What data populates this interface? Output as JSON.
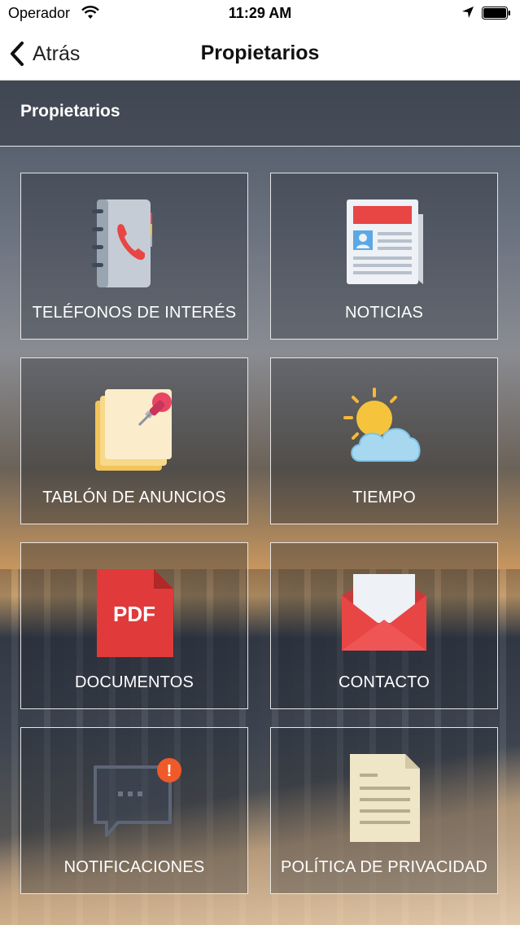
{
  "status_bar": {
    "carrier": "Operador",
    "time": "11:29 AM"
  },
  "nav": {
    "back_label": "Atrás",
    "title": "Propietarios"
  },
  "section": {
    "title": "Propietarios"
  },
  "tiles": [
    {
      "label": "TELÉFONOS DE INTERÉS",
      "icon": "phonebook-icon"
    },
    {
      "label": "NOTICIAS",
      "icon": "newspaper-icon"
    },
    {
      "label": "TABLÓN DE ANUNCIOS",
      "icon": "sticky-notes-icon"
    },
    {
      "label": "TIEMPO",
      "icon": "weather-icon"
    },
    {
      "label": "DOCUMENTOS",
      "icon": "pdf-icon",
      "icon_text": "PDF"
    },
    {
      "label": "CONTACTO",
      "icon": "envelope-icon"
    },
    {
      "label": "NOTIFICACIONES",
      "icon": "chat-bubble-icon",
      "badge": "!"
    },
    {
      "label": "POLÍTICA DE PRIVACIDAD",
      "icon": "document-icon"
    }
  ],
  "colors": {
    "red": "#e84545",
    "tile_border": "#e6e6e6",
    "badge": "#f05a28"
  }
}
